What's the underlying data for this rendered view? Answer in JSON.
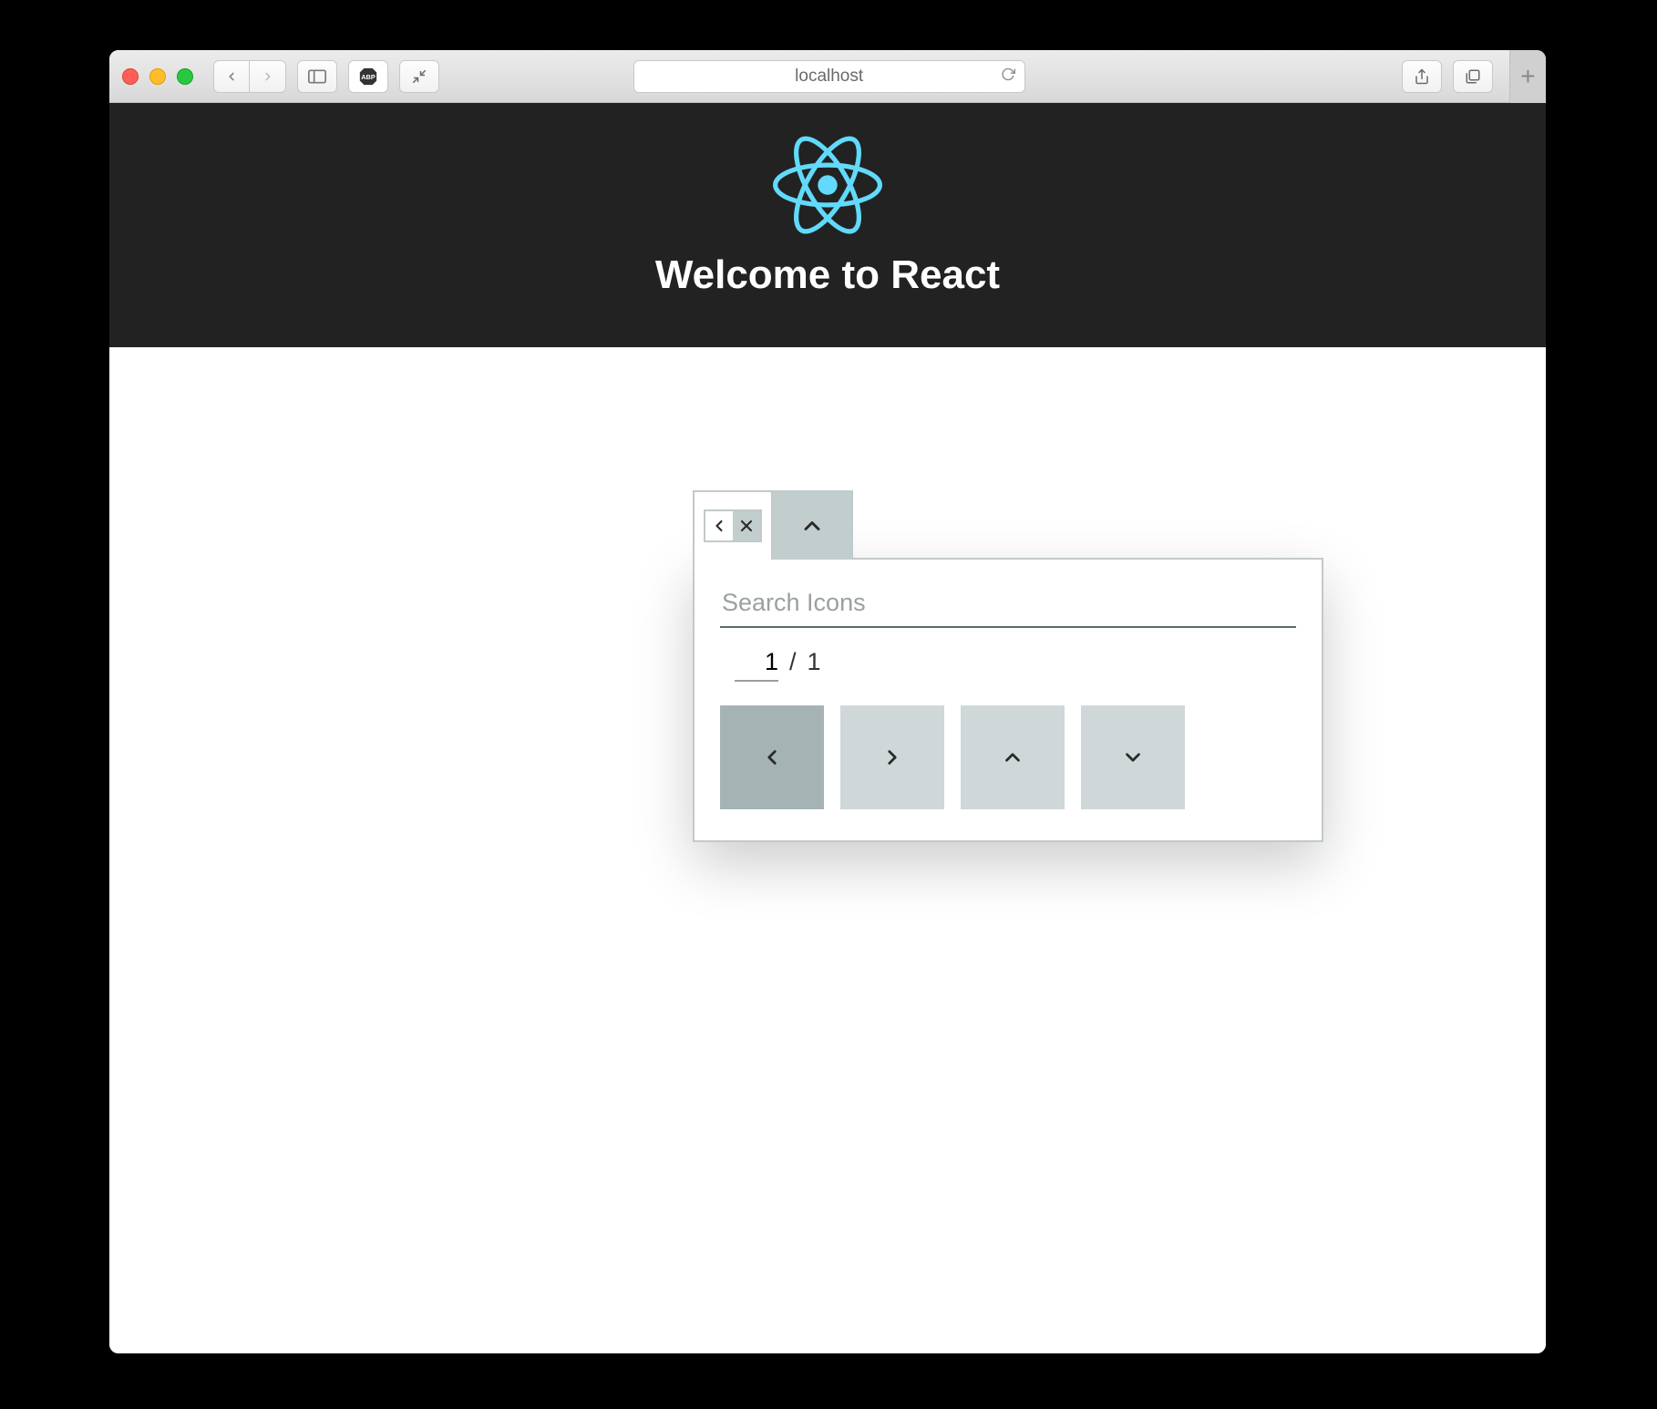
{
  "browser": {
    "address": "localhost"
  },
  "header": {
    "title": "Welcome to React"
  },
  "picker": {
    "search_placeholder": "Search Icons",
    "page_current": "1",
    "page_sep": "/",
    "page_total": "1",
    "icons": [
      {
        "name": "chevron-left",
        "selected": true
      },
      {
        "name": "chevron-right",
        "selected": false
      },
      {
        "name": "chevron-up",
        "selected": false
      },
      {
        "name": "chevron-down",
        "selected": false
      }
    ]
  }
}
